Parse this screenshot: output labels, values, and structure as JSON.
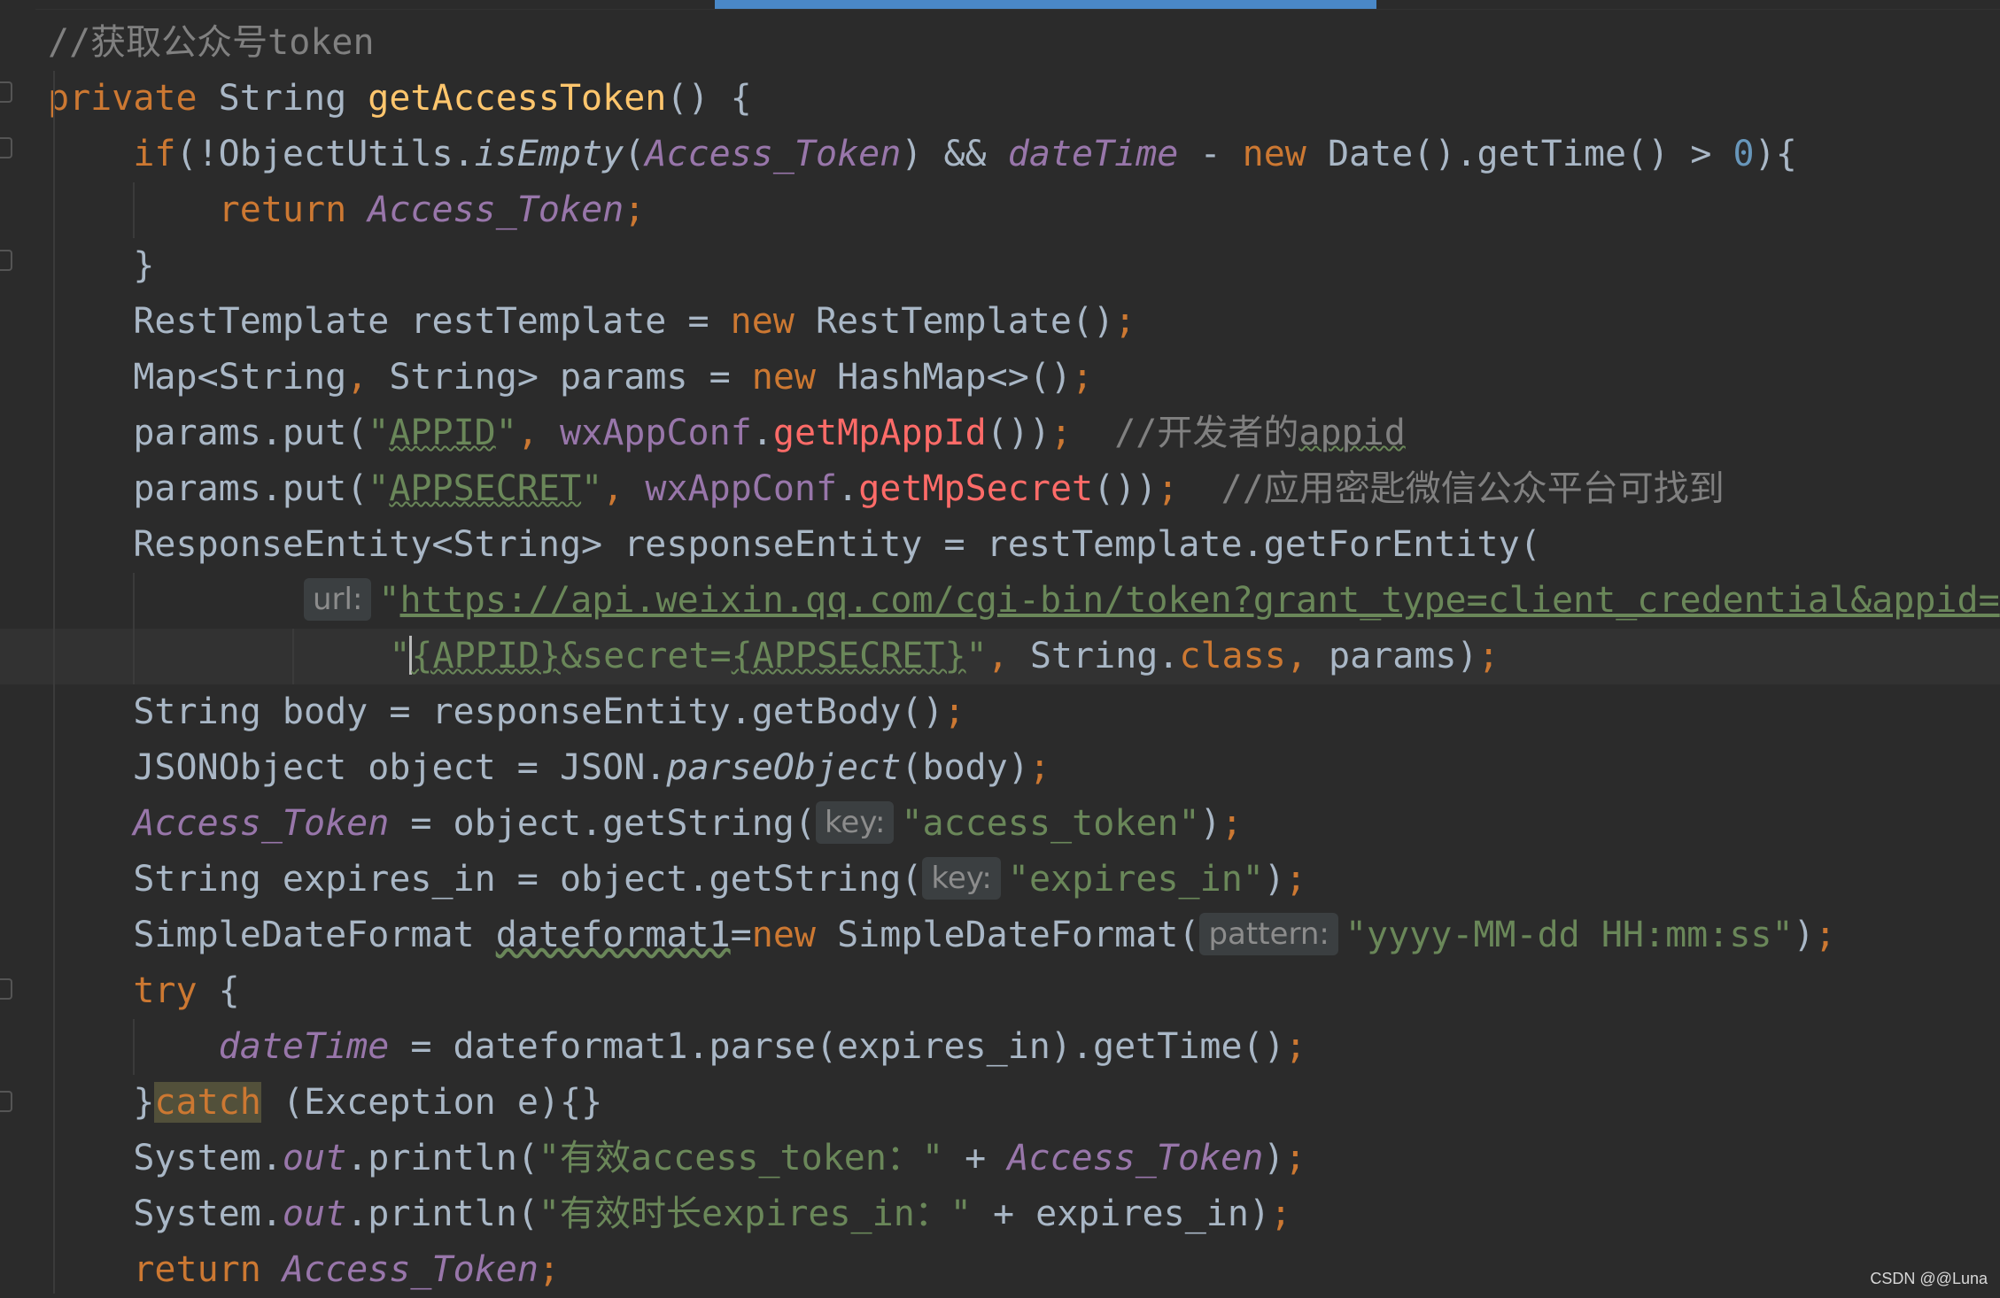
{
  "editor": {
    "lines": [
      [
        {
          "t": "//获取公众号token",
          "c": "cm"
        }
      ],
      [
        {
          "t": "private",
          "c": "kw"
        },
        {
          "t": " String "
        },
        {
          "t": "getAccessToken",
          "c": "fn"
        },
        {
          "t": "() {"
        }
      ],
      [
        {
          "t": "    "
        },
        {
          "t": "if",
          "c": "kw"
        },
        {
          "t": "(!ObjectUtils."
        },
        {
          "t": "isEmpty",
          "c": "it"
        },
        {
          "t": "("
        },
        {
          "t": "Access_Token",
          "c": "fld"
        },
        {
          "t": ") && "
        },
        {
          "t": "dateTime",
          "c": "fld"
        },
        {
          "t": " - "
        },
        {
          "t": "new",
          "c": "kw"
        },
        {
          "t": " Date().getTime() > "
        },
        {
          "t": "0",
          "c": "num"
        },
        {
          "t": "){"
        }
      ],
      [
        {
          "t": "        "
        },
        {
          "t": "return",
          "c": "kw"
        },
        {
          "t": " "
        },
        {
          "t": "Access_Token",
          "c": "fld"
        },
        {
          "t": ";",
          "c": "kw"
        }
      ],
      [
        {
          "t": "    }"
        }
      ],
      [
        {
          "t": "    RestTemplate restTemplate = "
        },
        {
          "t": "new",
          "c": "kw"
        },
        {
          "t": " RestTemplate()"
        },
        {
          "t": ";",
          "c": "kw"
        }
      ],
      [
        {
          "t": "    Map<String"
        },
        {
          "t": ",",
          "c": "kw"
        },
        {
          "t": " String> params = "
        },
        {
          "t": "new",
          "c": "kw"
        },
        {
          "t": " HashMap<>()"
        },
        {
          "t": ";",
          "c": "kw"
        }
      ],
      [
        {
          "t": "    params.put("
        },
        {
          "t": "\"",
          "c": "str"
        },
        {
          "t": "APPID",
          "c": "str wavy"
        },
        {
          "t": "\"",
          "c": "str"
        },
        {
          "t": ",",
          "c": "kw"
        },
        {
          "t": " "
        },
        {
          "t": "wxAppConf",
          "c": "fld-plain"
        },
        {
          "t": "."
        },
        {
          "t": "getMpAppId",
          "c": "mth"
        },
        {
          "t": "())"
        },
        {
          "t": ";",
          "c": "kw"
        },
        {
          "t": "  "
        },
        {
          "t": "//开发者的",
          "c": "cm"
        },
        {
          "t": "appid",
          "c": "cm wavy"
        }
      ],
      [
        {
          "t": "    params.put("
        },
        {
          "t": "\"",
          "c": "str"
        },
        {
          "t": "APPSECRET",
          "c": "str wavy"
        },
        {
          "t": "\"",
          "c": "str"
        },
        {
          "t": ",",
          "c": "kw"
        },
        {
          "t": " "
        },
        {
          "t": "wxAppConf",
          "c": "fld-plain"
        },
        {
          "t": "."
        },
        {
          "t": "getMpSecret",
          "c": "mth"
        },
        {
          "t": "())"
        },
        {
          "t": ";",
          "c": "kw"
        },
        {
          "t": "  "
        },
        {
          "t": "//应用密匙微信公众平台可找到",
          "c": "cm"
        }
      ],
      [
        {
          "t": "    ResponseEntity<String> responseEntity = restTemplate.getForEntity("
        }
      ],
      [
        {
          "t": "            "
        },
        {
          "t": "url:",
          "c": "hint"
        },
        {
          "t": "\"",
          "c": "str"
        },
        {
          "t": "https://api.weixin.qq.com/cgi-bin/token?grant_type=client_credential&appid=",
          "c": "str url"
        },
        {
          "t": "\"",
          "c": "str"
        },
        {
          "t": " +"
        }
      ],
      [
        {
          "t": "                \"",
          "c": "str"
        },
        {
          "t": "CARET",
          "c": "caret"
        },
        {
          "t": "{APPID}",
          "c": "str wavy"
        },
        {
          "t": "&secret=",
          "c": "str"
        },
        {
          "t": "{APPSECRET}",
          "c": "str wavy"
        },
        {
          "t": "\"",
          "c": "str"
        },
        {
          "t": ",",
          "c": "kw"
        },
        {
          "t": " String."
        },
        {
          "t": "class",
          "c": "kw"
        },
        {
          "t": ",",
          "c": "kw"
        },
        {
          "t": " params)"
        },
        {
          "t": ";",
          "c": "kw"
        }
      ],
      [
        {
          "t": "    String body = responseEntity.getBody()"
        },
        {
          "t": ";",
          "c": "kw"
        }
      ],
      [
        {
          "t": "    JSONObject object = JSON."
        },
        {
          "t": "parseObject",
          "c": "it"
        },
        {
          "t": "(body)"
        },
        {
          "t": ";",
          "c": "kw"
        }
      ],
      [
        {
          "t": "    "
        },
        {
          "t": "Access_Token",
          "c": "fld"
        },
        {
          "t": " = object.getString("
        },
        {
          "t": "key:",
          "c": "hint"
        },
        {
          "t": "\"access_token\"",
          "c": "str"
        },
        {
          "t": ")"
        },
        {
          "t": ";",
          "c": "kw"
        }
      ],
      [
        {
          "t": "    String expires_in = object.getString("
        },
        {
          "t": "key:",
          "c": "hint"
        },
        {
          "t": "\"expires_in\"",
          "c": "str"
        },
        {
          "t": ")"
        },
        {
          "t": ";",
          "c": "kw"
        }
      ],
      [
        {
          "t": "    SimpleDateFormat "
        },
        {
          "t": "dateformat1",
          "c": "wavy-plain"
        },
        {
          "t": "="
        },
        {
          "t": "new",
          "c": "kw"
        },
        {
          "t": " SimpleDateFormat("
        },
        {
          "t": "pattern:",
          "c": "hint"
        },
        {
          "t": "\"yyyy-MM-dd HH:mm:ss\"",
          "c": "str"
        },
        {
          "t": ")"
        },
        {
          "t": ";",
          "c": "kw"
        }
      ],
      [
        {
          "t": "    "
        },
        {
          "t": "try",
          "c": "kw"
        },
        {
          "t": " {"
        }
      ],
      [
        {
          "t": "        "
        },
        {
          "t": "dateTime",
          "c": "fld"
        },
        {
          "t": " = dateformat1.parse(expires_in).getTime()"
        },
        {
          "t": ";",
          "c": "kw"
        }
      ],
      [
        {
          "t": "    }"
        },
        {
          "t": "catch",
          "c": "kw catchbg"
        },
        {
          "t": " (Exception e){}"
        }
      ],
      [
        {
          "t": "    System."
        },
        {
          "t": "out",
          "c": "fld"
        },
        {
          "t": ".println("
        },
        {
          "t": "\"有效access_token：\"",
          "c": "str"
        },
        {
          "t": " + "
        },
        {
          "t": "Access_Token",
          "c": "fld"
        },
        {
          "t": ")"
        },
        {
          "t": ";",
          "c": "kw"
        }
      ],
      [
        {
          "t": "    System."
        },
        {
          "t": "out",
          "c": "fld"
        },
        {
          "t": ".println("
        },
        {
          "t": "\"有效时长expires_in：\"",
          "c": "str"
        },
        {
          "t": " + expires_in)"
        },
        {
          "t": ";",
          "c": "kw"
        }
      ],
      [
        {
          "t": "    "
        },
        {
          "t": "return",
          "c": "kw"
        },
        {
          "t": " "
        },
        {
          "t": "Access_Token",
          "c": "fld"
        },
        {
          "t": ";",
          "c": "kw"
        }
      ]
    ]
  },
  "watermark": "CSDN @@Luna",
  "colors": {
    "background": "#2b2b2b",
    "keyword": "#cc7832",
    "method": "#ffc66d",
    "field": "#9876aa",
    "string": "#6a8759",
    "comment": "#808080",
    "number": "#6897bb",
    "text": "#a9b7c6"
  }
}
